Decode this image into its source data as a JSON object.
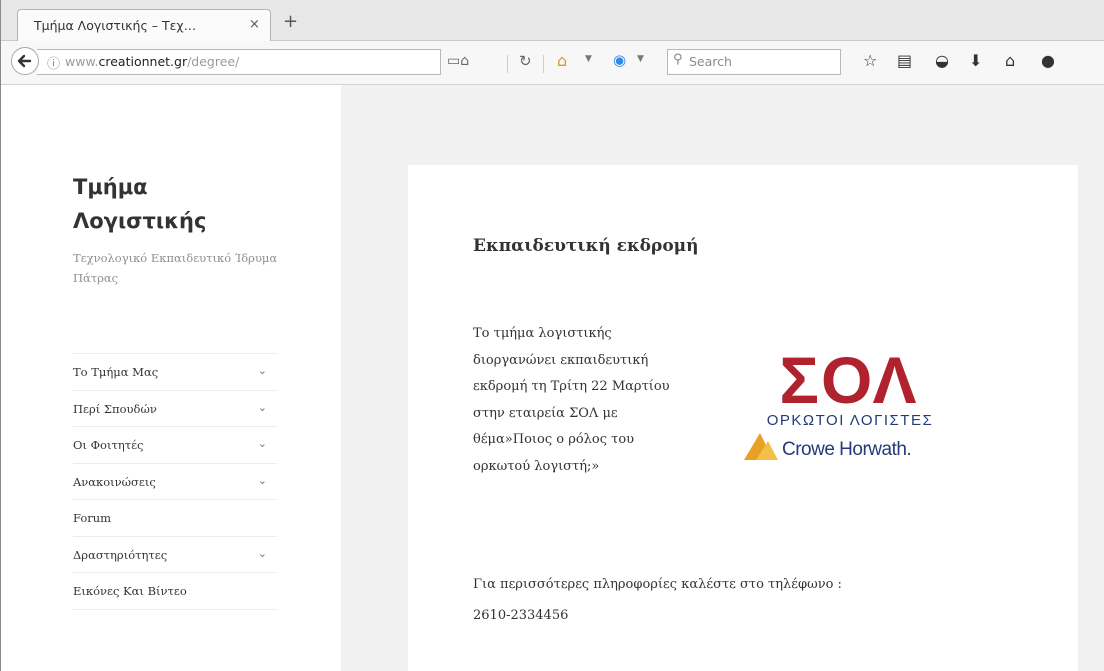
{
  "browser": {
    "tab_title": "Τμήμα Λογιστικής – Τεχ…",
    "tab_close": "×",
    "new_tab": "+",
    "url_prefix": "www.",
    "url_domain": "creationnet.gr",
    "url_path": "/degree/",
    "search_placeholder": "Search"
  },
  "site": {
    "title": "Τμήμα Λογιστικής",
    "description": "Τεχνολογικό Εκπαιδευτικό Ίδρυμα Πάτρας"
  },
  "menu": {
    "items": [
      {
        "label": "Το Τμήμα Μας",
        "has_submenu": true
      },
      {
        "label": "Περί Σπουδών",
        "has_submenu": true
      },
      {
        "label": "Οι Φοιτητές",
        "has_submenu": true
      },
      {
        "label": "Ανακοινώσεις",
        "has_submenu": true
      },
      {
        "label": "Forum",
        "has_submenu": false
      },
      {
        "label": "Δραστηριότητες",
        "has_submenu": true
      },
      {
        "label": "Εικόνες Και Βίντεο",
        "has_submenu": false
      }
    ],
    "chevron": "⌄"
  },
  "post": {
    "title": "Εκπαιδευτική εκδρομή",
    "body": "Το τμήμα λογιστικής διοργανώνει εκπαιδευτική εκδρομή τη Τρίτη 22 Μαρτίου στην εταιρεία ΣΟΛ με θέμα»Ποιος ο ρόλος του ορκωτού λογιστή;»",
    "info_line": "Για περισσότερες πληροφορίες καλέστε στο τηλέφωνο :",
    "phone": "2610-2334456"
  },
  "logo": {
    "main_text": "ΣΟΛ",
    "subtitle": "ΟΡΚΩΤΟΙ ΛΟΓΙΣΤΕΣ",
    "partner": "Crowe Horwath.",
    "color_red": "#b0232e",
    "color_blue": "#243a7a",
    "color_gold": "#e7a226"
  },
  "colors": {
    "content_bg": "#f1f1f1",
    "sidebar_bg": "#ffffff",
    "text": "#333333",
    "muted": "#8f8f8f"
  },
  "icons": [
    "back-arrow-icon",
    "info-icon",
    "reader-view-icon",
    "reload-icon",
    "home-icon",
    "extension-icon",
    "search-icon",
    "bookmark-star-icon",
    "bookmarks-list-icon",
    "pocket-icon",
    "download-icon",
    "home-icon",
    "chat-icon"
  ]
}
